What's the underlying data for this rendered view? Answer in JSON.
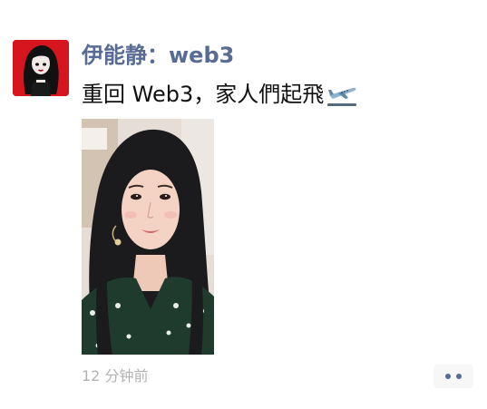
{
  "post": {
    "author_line": "伊能静：web3",
    "text": "重回 Web3，家人們起飛",
    "text_emoji_icon": "airplane-departure-icon",
    "photo_subject": "woman-selfie",
    "timestamp": "12 分钟前",
    "more_button_icon": "ellipsis-icon"
  },
  "colors": {
    "name_link": "#576b95",
    "body_text": "#111111",
    "timestamp": "#b2b2b2",
    "avatar_bg": "#d7151f",
    "more_button_bg": "#f7f7f7"
  }
}
